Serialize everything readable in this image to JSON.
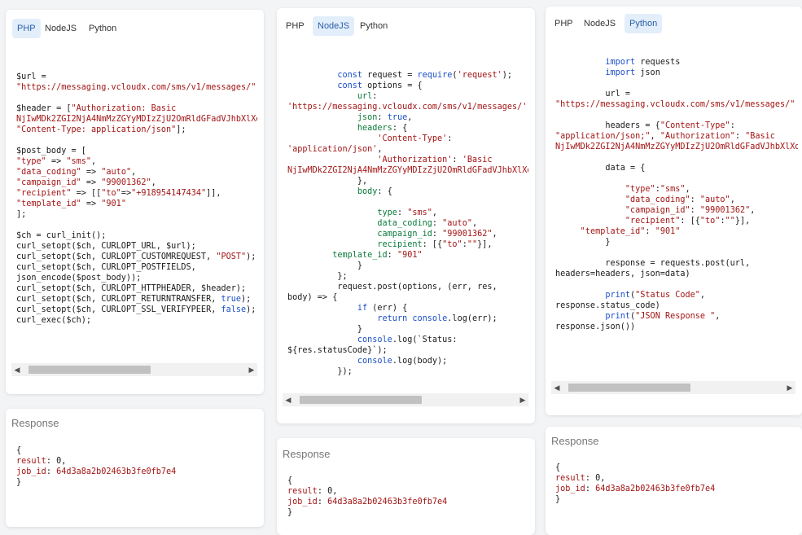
{
  "tabs": {
    "php": "PHP",
    "node": "NodeJS",
    "python": "Python"
  },
  "response": {
    "title": "Response",
    "open": "{",
    "result_key": "result",
    "result_value": "0,",
    "job_key": "job_id",
    "job_value": "64d3a8a2b02463b3fe0fb7e4",
    "close": "}"
  },
  "panels": [
    {
      "language": "PHP",
      "active_tab": "PHP"
    },
    {
      "language": "NodeJS",
      "active_tab": "NodeJS"
    },
    {
      "language": "Python",
      "active_tab": "Python"
    }
  ],
  "icons": {
    "scroll_left": "arrow-left-icon",
    "scroll_right": "arrow-right-icon"
  },
  "colors": {
    "accent": "#2a5fa8",
    "active_tab_bg": "#e3eefb",
    "string": "#a31515",
    "keyword": "#1b4fc7"
  }
}
